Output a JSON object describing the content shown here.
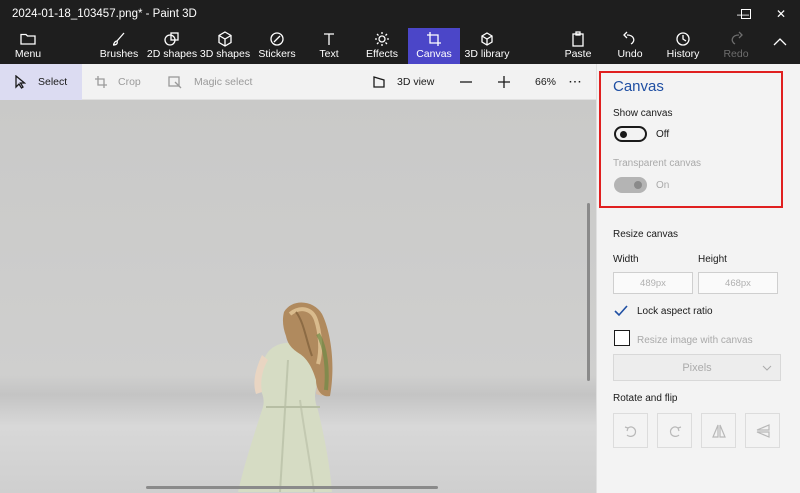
{
  "window": {
    "title": "2024-01-18_103457.png* - Paint 3D",
    "minimize_glyph": "—",
    "maximize_glyph": "☐",
    "close_glyph": "✕"
  },
  "ribbon": {
    "menu": "Menu",
    "tools": [
      "Brushes",
      "2D shapes",
      "3D shapes",
      "Stickers",
      "Text",
      "Effects",
      "Canvas",
      "3D library"
    ],
    "active_tool": "Canvas",
    "paste": "Paste",
    "undo": "Undo",
    "history": "History",
    "redo": "Redo"
  },
  "toolbar": {
    "select": "Select",
    "crop": "Crop",
    "magic_select": "Magic select",
    "view_3d": "3D view",
    "zoom": "66%",
    "more": "···"
  },
  "panel": {
    "title": "Canvas",
    "show_canvas_label": "Show canvas",
    "show_canvas_state": "Off",
    "transparent_label": "Transparent canvas",
    "transparent_state": "On",
    "resize_label": "Resize canvas",
    "width_label": "Width",
    "height_label": "Height",
    "width_placeholder": "489px",
    "height_placeholder": "468px",
    "lock_aspect": "Lock aspect ratio",
    "lock_aspect_checked": true,
    "resize_with_canvas": "Resize image with canvas",
    "resize_with_canvas_checked": false,
    "units": "Pixels",
    "rotate_flip_label": "Rotate and flip"
  },
  "colors": {
    "accent": "#4b46c8",
    "highlight": "#e01f1f",
    "title_blue": "#1f4fa3"
  }
}
